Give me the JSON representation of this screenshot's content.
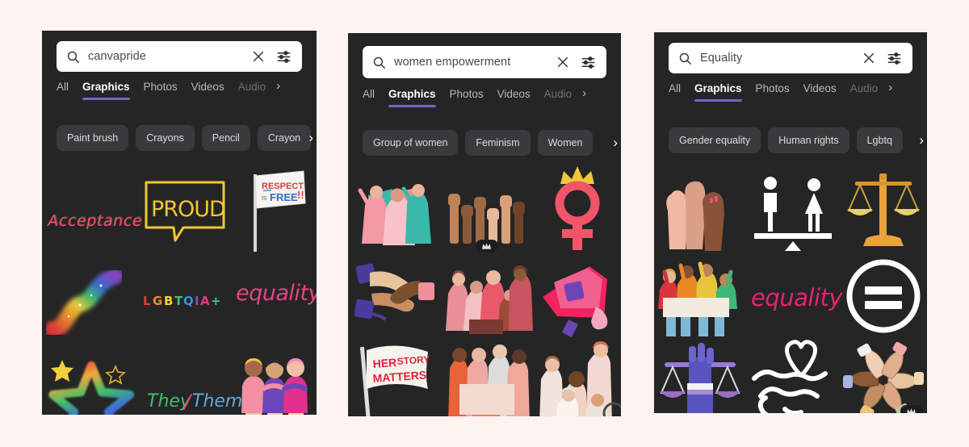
{
  "page": {
    "background_color": "#fdf4f1",
    "panel_color": "#252526",
    "accent_color": "#7b61c9"
  },
  "icons": {
    "search": "search-icon",
    "clear": "close-icon",
    "filter": "filter-sliders-icon",
    "next": "chevron-right-icon",
    "crown": "crown-icon"
  },
  "panels": [
    {
      "id": "panel-1",
      "search": {
        "value": "canvapride",
        "placeholder": "Search"
      },
      "tabs": [
        {
          "label": "All",
          "active": false
        },
        {
          "label": "Graphics",
          "active": true
        },
        {
          "label": "Photos",
          "active": false
        },
        {
          "label": "Videos",
          "active": false
        },
        {
          "label": "Audio",
          "active": false
        }
      ],
      "tabs_next": "›",
      "chips": [
        "Paint brush",
        "Crayons",
        "Pencil",
        "Crayon"
      ],
      "chips_next": "›",
      "results": [
        {
          "name": "acceptance-lettering",
          "label": "Acceptance"
        },
        {
          "name": "proud-speech-bubble",
          "label": "PROUD"
        },
        {
          "name": "respect-is-free-flag",
          "label": "RESPECT is FREE!!"
        },
        {
          "name": "rainbow-brush-stroke",
          "label": "Rainbow stroke"
        },
        {
          "name": "lgbtqia-plus-lettering",
          "label": "LGBTQIA+"
        },
        {
          "name": "equality-script-lettering",
          "label": "equality"
        },
        {
          "name": "rainbow-star",
          "label": "Rainbow star"
        },
        {
          "name": "they-them-lettering",
          "label": "They / Them"
        },
        {
          "name": "three-friends-illustration",
          "label": "Three friends"
        }
      ]
    },
    {
      "id": "panel-2",
      "search": {
        "value": "women empowerment",
        "placeholder": "Search"
      },
      "tabs": [
        {
          "label": "All",
          "active": false
        },
        {
          "label": "Graphics",
          "active": true
        },
        {
          "label": "Photos",
          "active": false
        },
        {
          "label": "Videos",
          "active": false
        },
        {
          "label": "Audio",
          "active": false
        }
      ],
      "tabs_next": "›",
      "chips": [
        "Group of women",
        "Feminism",
        "Women"
      ],
      "chips_next": "›",
      "results": [
        {
          "name": "women-with-flags",
          "label": "Women with flags",
          "pro": false
        },
        {
          "name": "raised-fists-row",
          "label": "Raised fists",
          "pro": true
        },
        {
          "name": "venus-symbol-crown",
          "label": "Venus symbol with crown",
          "pro": false
        },
        {
          "name": "hands-stacked",
          "label": "Stacked hands",
          "pro": false
        },
        {
          "name": "group-of-women-pink",
          "label": "Group of women",
          "pro": false
        },
        {
          "name": "pink-megaphone",
          "label": "Megaphone",
          "pro": false
        },
        {
          "name": "herstory-matters-flag",
          "label": "HER STORY MATTERS",
          "pro": false
        },
        {
          "name": "women-holding-banner",
          "label": "Women holding banner",
          "pro": false
        },
        {
          "name": "diverse-women-group",
          "label": "Diverse women group",
          "pro": false
        }
      ]
    },
    {
      "id": "panel-3",
      "search": {
        "value": "Equality",
        "placeholder": "Search"
      },
      "tabs": [
        {
          "label": "All",
          "active": false
        },
        {
          "label": "Graphics",
          "active": true
        },
        {
          "label": "Photos",
          "active": false
        },
        {
          "label": "Videos",
          "active": false
        },
        {
          "label": "Audio",
          "active": false
        }
      ],
      "tabs_next": "›",
      "chips": [
        "Gender equality",
        "Human rights",
        "Lgbtq"
      ],
      "chips_next": "›",
      "results": [
        {
          "name": "raised-fists-unity",
          "label": "Raised fists",
          "pro": false
        },
        {
          "name": "gender-balance-seesaw",
          "label": "Gender balance seesaw",
          "pro": false
        },
        {
          "name": "gold-justice-scales",
          "label": "Scales of justice",
          "pro": false
        },
        {
          "name": "protesters-with-banner",
          "label": "Protesters with banner",
          "pro": false
        },
        {
          "name": "equality-script-lettering",
          "label": "equality",
          "pro": false
        },
        {
          "name": "equals-sign-circle",
          "label": "Equals sign",
          "pro": false
        },
        {
          "name": "purple-fist-scales",
          "label": "Fist and scales",
          "pro": false
        },
        {
          "name": "handshake-heart-outline",
          "label": "Handshake with heart",
          "pro": false
        },
        {
          "name": "circle-of-hands",
          "label": "Circle of hands",
          "pro": true
        }
      ]
    }
  ]
}
